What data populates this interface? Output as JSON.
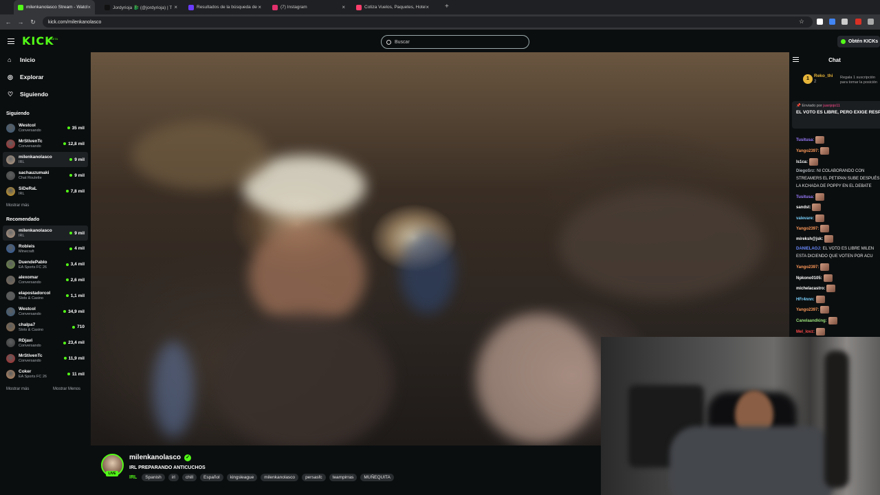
{
  "browser": {
    "tabs": [
      {
        "title": "milenkanolasco Stream - Watch",
        "color": "#53fc18",
        "active": true
      },
      {
        "title": "Jordyrioja 🐉 (@jordyrioja) | T",
        "color": "#111111",
        "active": false
      },
      {
        "title": "Resultados de la búsqueda de",
        "color": "#6b3cff",
        "active": false
      },
      {
        "title": "(7) Instagram",
        "color": "#e1306c",
        "active": false
      },
      {
        "title": "Cotiza Vuelos, Paquetes, Hoteles",
        "color": "#ff3e6c",
        "active": false
      }
    ],
    "close_glyph": "×",
    "new_tab_glyph": "+",
    "url": "kick.com/milenkanolasco"
  },
  "header": {
    "logo": "KICK",
    "logo_beta": "BETA",
    "search_placeholder": "Buscar",
    "get_kicks": "Obtén KICKs"
  },
  "sidebar": {
    "nav": [
      {
        "label": "Inicio",
        "icon": "home-icon",
        "glyph": "⌂"
      },
      {
        "label": "Explorar",
        "icon": "compass-icon",
        "glyph": "◎"
      },
      {
        "label": "Siguiendo",
        "icon": "heart-icon",
        "glyph": "♡"
      }
    ],
    "following_title": "Siguiendo",
    "following": [
      {
        "name": "Westcol",
        "category": "Conversando",
        "viewers": "35 mil",
        "color": "#3a5a7a"
      },
      {
        "name": "MrStivenTc",
        "category": "Conversando",
        "viewers": "12,8 mil",
        "color": "#b02a2a"
      },
      {
        "name": "milenkanolasco",
        "category": "IRL",
        "viewers": "9 mil",
        "color": "#b89a80"
      },
      {
        "name": "sachauzumaki",
        "category": "Chat Roulette",
        "viewers": "9 mil",
        "color": "#444444"
      },
      {
        "name": "SiDeRaL",
        "category": "IRL",
        "viewers": "7,8 mil",
        "color": "#d9a020"
      }
    ],
    "show_more_1": "Mostrar más",
    "recommended_title": "Recomendado",
    "recommended": [
      {
        "name": "milenkanolasco",
        "category": "IRL",
        "viewers": "9 mil",
        "color": "#b89a80"
      },
      {
        "name": "Robleis",
        "category": "Minecraft",
        "viewers": "4 mil",
        "color": "#2a5aa0"
      },
      {
        "name": "DuendePablo",
        "category": "EA Sports FC 26",
        "viewers": "3,4 mil",
        "color": "#6a8a40"
      },
      {
        "name": "alexomar",
        "category": "Conversando",
        "viewers": "2,6 mil",
        "color": "#7a6a5a"
      },
      {
        "name": "elapostadorcol",
        "category": "Slots & Casino",
        "viewers": "1,1 mil",
        "color": "#555555"
      },
      {
        "name": "Westcol",
        "category": "Conversando",
        "viewers": "34,9 mil",
        "color": "#3a5a7a"
      },
      {
        "name": "chalpa7",
        "category": "Slots & Casino",
        "viewers": "710",
        "color": "#8a6a4a"
      },
      {
        "name": "RDjavi",
        "category": "Conversando",
        "viewers": "23,4 mil",
        "color": "#3a3a3a"
      },
      {
        "name": "MrStivenTc",
        "category": "Conversando",
        "viewers": "11,9 mil",
        "color": "#b02a2a"
      },
      {
        "name": "Coker",
        "category": "EA Sports FC 26",
        "viewers": "11 mil",
        "color": "#c08a60"
      }
    ],
    "show_more_2": "Mostrar más",
    "show_less": "Mostrar Menos"
  },
  "channel": {
    "name": "milenkanolasco",
    "live_badge": "LIVE",
    "verified_glyph": "✓",
    "title": "IRL PREPARANDO ANTICUCHOS",
    "category": "IRL",
    "tags": [
      "Spanish",
      "irl",
      "chill",
      "Español",
      "kingsleague",
      "milenkanolasco",
      "persasfc",
      "teampirras",
      "MUÑEQUITA"
    ]
  },
  "chat": {
    "title": "Chat",
    "leader": {
      "rank": "1",
      "name": "Reko_thi",
      "count": "2",
      "gift_text": "Regala 1 suscripción para tomar la posición"
    },
    "pinned": {
      "by": "Enviado por",
      "sender": "juanjojo11",
      "message": "EL VOTO ES LIBRE, PERO EXIGE RESPONSABILIDAD: INFORMARNOS"
    },
    "messages": [
      {
        "user": "Tusitusa:",
        "text": "",
        "color": "#9b7cff",
        "emote": true
      },
      {
        "user": "Yango2397:",
        "text": "",
        "color": "#ff9a5a",
        "emote": true
      },
      {
        "user": "ls1ca:",
        "text": "",
        "color": "#ffffff",
        "emote": true
      },
      {
        "user": "DiegoSrz:",
        "text": "NI COLABORANDO CON",
        "color": "#b0b6bb",
        "emote": false
      },
      {
        "user": "",
        "text": "STREAMERS EL PETIPAN SUBE DESPUÉS",
        "color": "#ffffff",
        "emote": false
      },
      {
        "user": "",
        "text": "LA KCHADA DE POPPY EN EL DEBATE",
        "color": "#ffffff",
        "emote": false
      },
      {
        "user": "Tusitusa:",
        "text": "",
        "color": "#9b7cff",
        "emote": true
      },
      {
        "user": "sandst:",
        "text": "",
        "color": "#ffffff",
        "emote": true
      },
      {
        "user": "valevare:",
        "text": "",
        "color": "#7ad3ff",
        "emote": true
      },
      {
        "user": "Yango2397:",
        "text": "",
        "color": "#ff9a5a",
        "emote": true
      },
      {
        "user": "mireksh@jsk:",
        "text": "",
        "color": "#ffffff",
        "emote": true
      },
      {
        "user": "DANIELAOJ:",
        "text": "EL VOTO ES LIBRE MILEN",
        "color": "#6a8aff",
        "emote": false
      },
      {
        "user": "",
        "text": "ESTA DICIENDO QUE VOTEN POR ACU",
        "color": "#ffffff",
        "emote": false
      },
      {
        "user": "Yango2397:",
        "text": "",
        "color": "#ff9a5a",
        "emote": true
      },
      {
        "user": "Npkono0105:",
        "text": "",
        "color": "#ffffff",
        "emote": true
      },
      {
        "user": "michelacastro:",
        "text": "",
        "color": "#ffffff",
        "emote": true
      },
      {
        "user": "HFr4nnn:",
        "text": "",
        "color": "#7ad3ff",
        "emote": true
      },
      {
        "user": "Yango2397:",
        "text": "",
        "color": "#ff9a5a",
        "emote": true
      },
      {
        "user": "Canelaandking:",
        "text": "",
        "color": "#9be07a",
        "emote": true
      },
      {
        "user": "Mel_lovz:",
        "text": "",
        "color": "#ff4a4a",
        "emote": true
      }
    ]
  }
}
